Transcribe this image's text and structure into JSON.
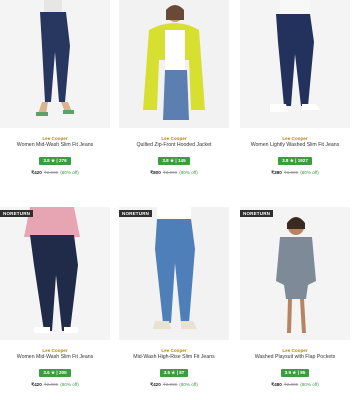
{
  "products": [
    {
      "badge": "",
      "brand": "Lee Cooper",
      "title": "Women Mid-Wash Slim Fit Jeans",
      "rating": "3.8 ★ | 276",
      "price": "₹420",
      "mrp": "₹2,999",
      "discount": "(80% off)"
    },
    {
      "badge": "",
      "brand": "Lee Cooper",
      "title": "Quilted Zip-Front Hooded Jacket",
      "rating": "3.8 ★ | 145",
      "price": "₹800",
      "mrp": "₹3,999",
      "discount": "(80% off)"
    },
    {
      "badge": "",
      "brand": "Lee Cooper",
      "title": "Women Lightly Washed Slim Fit Jeans",
      "rating": "3.8 ★ | 1927",
      "price": "₹380",
      "mrp": "₹1,899",
      "discount": "(80% off)"
    },
    {
      "badge": "NORETURN",
      "brand": "Lee Cooper",
      "title": "Women Mid-Wash Slim Fit Jeans",
      "rating": "3.6 ★ | 205",
      "price": "₹420",
      "mrp": "₹2,099",
      "discount": "(80% off)"
    },
    {
      "badge": "NORETURN",
      "brand": "Lee Cooper",
      "title": "Mid-Wash High-Rise Slim Fit Jeans",
      "rating": "3.6 ★ | 87",
      "price": "₹420",
      "mrp": "₹2,099",
      "discount": "(80% off)"
    },
    {
      "badge": "NORETURN",
      "brand": "Lee Cooper",
      "title": "Washed Playsuit with Flap Pockets",
      "rating": "3.9 ★ | 85",
      "price": "₹480",
      "mrp": "₹2,399",
      "discount": "(80% off)"
    }
  ],
  "colors": {
    "rating_bg": "#3c9c3f",
    "brand": "#b8860b",
    "badge_bg": "#2f2f2f"
  }
}
